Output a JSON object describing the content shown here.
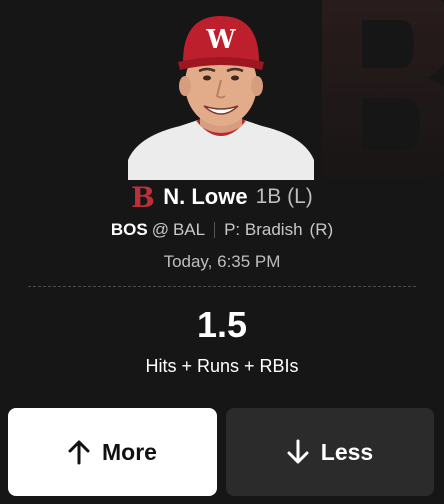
{
  "player": {
    "name": "N. Lowe",
    "position": "1B (L)",
    "team_logo": "boston-red-sox-b-logo",
    "team_logo_letter": "B"
  },
  "matchup": {
    "team": "BOS",
    "at": "@",
    "opponent": "BAL",
    "pitcher": "P: Bradish",
    "pitcher_hand": "(R)"
  },
  "game_time": "Today, 6:35 PM",
  "projection": {
    "line": "1.5",
    "stat": "Hits + Runs + RBIs"
  },
  "actions": {
    "more_label": "More",
    "less_label": "Less",
    "more_icon": "arrow-up-icon",
    "less_icon": "arrow-down-icon"
  },
  "colors": {
    "background": "#161616",
    "red_sox_red": "#bd3039",
    "more_button": "#ffffff",
    "less_button": "#2b2b2b"
  }
}
